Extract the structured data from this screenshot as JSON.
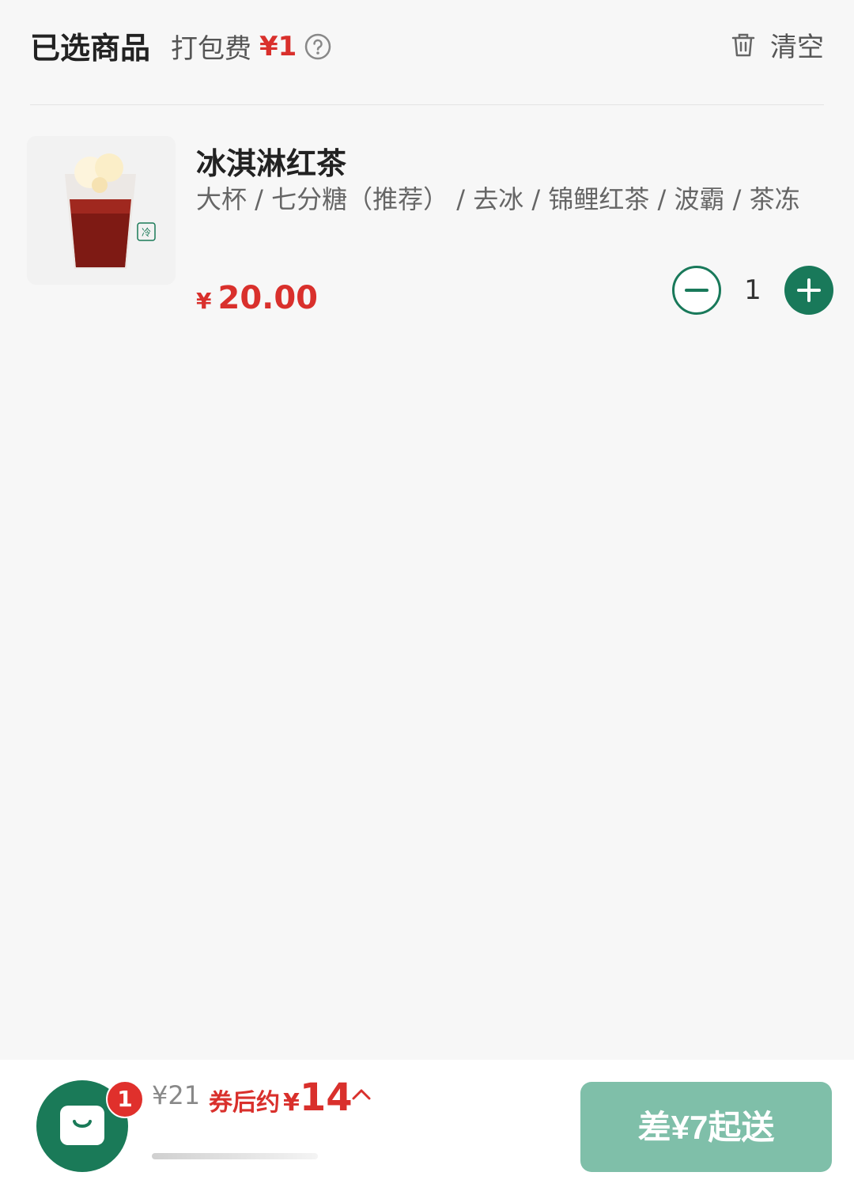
{
  "header": {
    "title": "已选商品",
    "fee_label": "打包费",
    "fee_amount": "¥1",
    "clear_label": "清空"
  },
  "item": {
    "name": "冰淇淋红茶",
    "spec": "大杯 / 七分糖（推荐） / 去冰 / 锦鲤红茶 / 波霸 / 茶冻",
    "price_currency": "¥",
    "price_value": "20.00",
    "quantity": "1",
    "thumb_tag": "冷"
  },
  "bottom": {
    "badge_count": "1",
    "original_total": "¥21",
    "after_coupon_label": "券后约",
    "after_coupon_currency": "¥",
    "after_coupon_value": "14",
    "checkout_label": "差¥7起送"
  },
  "colors": {
    "accent_green": "#19795a",
    "price_red": "#d9302c",
    "checkout_disabled": "#7fbfa9"
  }
}
